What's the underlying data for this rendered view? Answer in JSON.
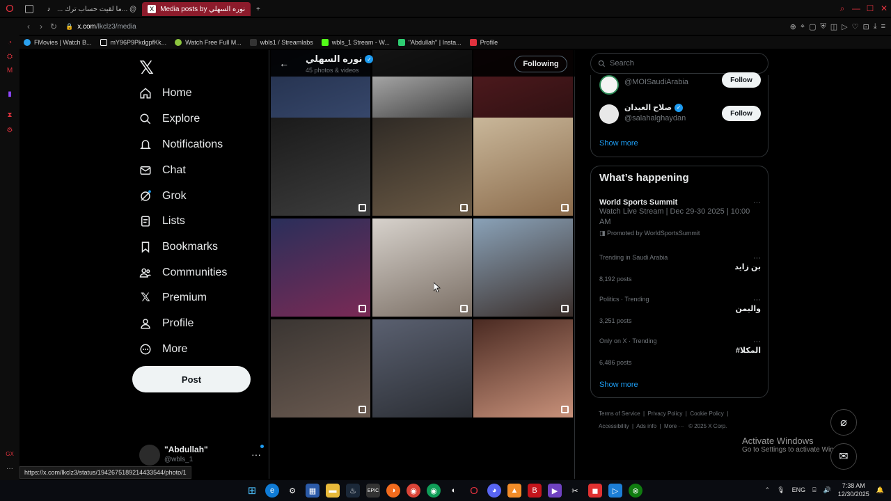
{
  "browser": {
    "tabs": [
      {
        "label": "",
        "icon": "workspaces-icon"
      },
      {
        "label": "... ما لقيت حساب ترك... @",
        "icon": "tiktok-icon"
      },
      {
        "label": "Media posts by نوره السهلي",
        "icon": "x-icon",
        "active": true
      }
    ],
    "new_tab": "+",
    "url_host": "x.com",
    "url_path": "/lkclz3/media",
    "bookmarks": [
      {
        "label": "FMovies | Watch B...",
        "color": "#2ba2f0"
      },
      {
        "label": "mY96P9PkdgpfKk...",
        "color": "#ffffff"
      },
      {
        "label": "Watch Free Full M...",
        "color": "#8dc63f"
      },
      {
        "label": "wbls1 / Streamlabs",
        "color": "#222222"
      },
      {
        "label": "wbls_1 Stream - W...",
        "color": "#53fc18"
      },
      {
        "label": "\"Abdullah\" | Insta...",
        "color": "#2ecc71"
      },
      {
        "label": "Profile",
        "color": "#e0323e"
      }
    ]
  },
  "nav": {
    "items": [
      {
        "label": "Home",
        "icon": "home-icon"
      },
      {
        "label": "Explore",
        "icon": "search-icon"
      },
      {
        "label": "Notifications",
        "icon": "bell-icon"
      },
      {
        "label": "Chat",
        "icon": "mail-icon"
      },
      {
        "label": "Grok",
        "icon": "grok-icon"
      },
      {
        "label": "Lists",
        "icon": "list-icon"
      },
      {
        "label": "Bookmarks",
        "icon": "bookmark-icon"
      },
      {
        "label": "Communities",
        "icon": "communities-icon"
      },
      {
        "label": "Premium",
        "icon": "x-icon"
      },
      {
        "label": "Profile",
        "icon": "person-icon"
      },
      {
        "label": "More",
        "icon": "more-circle-icon"
      }
    ],
    "post_label": "Post",
    "account_name": "\"Abdullah\"",
    "account_handle": "@wbls_1",
    "account_more": "···",
    "status_url": "https://x.com/lkclz3/status/1942675189214433544/photo/1"
  },
  "profile": {
    "name": "نوره السهلي",
    "count": "45 photos & videos",
    "following_label": "Following"
  },
  "media_tiles": [
    {
      "colors": [
        "#1e2a44",
        "#3a4b70"
      ],
      "multi": true
    },
    {
      "colors": [
        "#d9d9d9",
        "#2a2a2a"
      ],
      "multi": false
    },
    {
      "colors": [
        "#5a1d22",
        "#2a0f10"
      ],
      "multi": true
    },
    {
      "colors": [
        "#1a1a1a",
        "#3d3d3d"
      ],
      "multi": true
    },
    {
      "colors": [
        "#2f2a25",
        "#6b5a45"
      ],
      "multi": true
    },
    {
      "colors": [
        "#c9b79a",
        "#8a6a4a"
      ],
      "multi": true
    },
    {
      "colors": [
        "#2a2f5a",
        "#7a2a55"
      ],
      "multi": true
    },
    {
      "colors": [
        "#d7d2cc",
        "#7a6e64"
      ],
      "multi": true
    },
    {
      "colors": [
        "#8aa2b8",
        "#3a2e2a"
      ],
      "multi": true
    },
    {
      "colors": [
        "#3a3532",
        "#6a5a50"
      ],
      "multi": true
    },
    {
      "colors": [
        "#5a6070",
        "#2a2d33"
      ],
      "multi": false
    },
    {
      "colors": [
        "#4a2a22",
        "#c8917a"
      ],
      "multi": true
    }
  ],
  "right": {
    "search_placeholder": "Search",
    "who_to_follow": [
      {
        "name": "",
        "handle": "@MOISaudiArabia",
        "follow_label": "Follow",
        "avatar_color": "#2e8b57"
      },
      {
        "name": "صلاح الغيدان",
        "handle": "@salahalghaydan",
        "follow_label": "Follow",
        "avatar_color": "#e8e8e8"
      }
    ],
    "show_more": "Show more",
    "whats_happening_title": "What’s happening",
    "promoted": {
      "title": "World Sports Summit",
      "desc": "Watch Live Stream | Dec 29-30 2025 | 10:00 AM",
      "by": "Promoted by WorldSportsSummit"
    },
    "trends": [
      {
        "meta": "Trending in Saudi Arabia",
        "title": "بن زايد",
        "posts": "8,192 posts"
      },
      {
        "meta": "Politics · Trending",
        "title": "واليمن",
        "posts": "3,251 posts"
      },
      {
        "meta": "Only on X · Trending",
        "title": "#المكلا",
        "posts": "6,486 posts"
      }
    ],
    "show_more_2": "Show more",
    "footer": [
      "Terms of Service",
      "Privacy Policy",
      "Cookie Policy",
      "Accessibility",
      "Ads info",
      "More ···",
      "© 2025 X Corp."
    ]
  },
  "windows": {
    "activate_title": "Activate Windows",
    "activate_sub": "Go to Settings to activate Windows.",
    "lang": "ENG",
    "time": "7:38 AM",
    "date": "12/30/2025"
  }
}
